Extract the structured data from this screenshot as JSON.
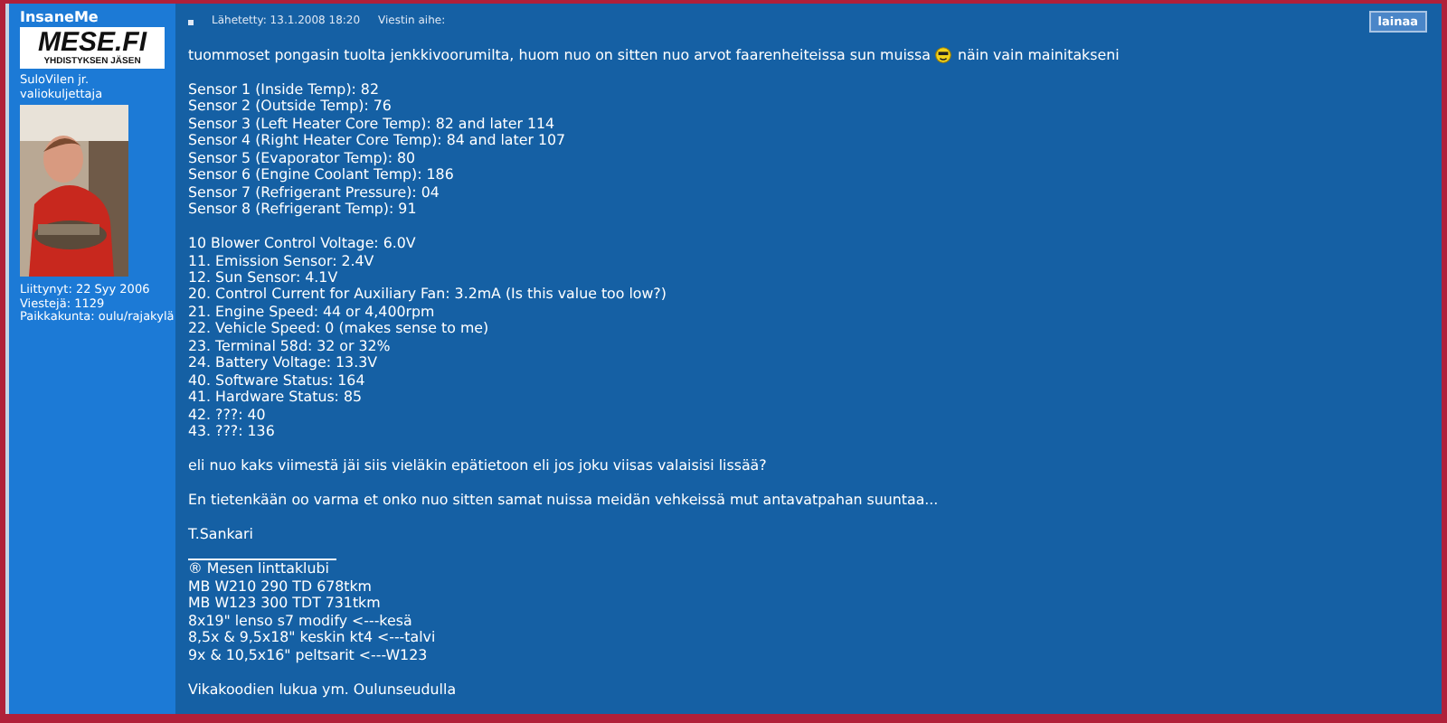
{
  "author": {
    "username": "InsaneMe",
    "logo_title": "MESE.FI",
    "logo_subtitle": "YHDISTYKSEN JÄSEN",
    "rank_lines": [
      "SuloVilen jr.",
      "valiokuljettaja"
    ],
    "avatar": {
      "kind": "picture"
    },
    "info": [
      "Liittynyt: 22 Syy 2006",
      "Viestejä: 1129",
      "Paikkakunta: oulu/rajakylä"
    ]
  },
  "post_header": {
    "posted": "Lähetetty: 13.1.2008 18:20",
    "subject_label": "Viestin aihe:"
  },
  "quote_button": "lainaa",
  "body": [
    {
      "kind": "intro",
      "before": "tuommoset pongasin tuolta jenkkivoorumilta, huom nuo on sitten nuo arvot faarenheiteissa sun muissa",
      "after": "näin vain mainitakseni"
    },
    {
      "kind": "lines",
      "lines": [
        "Sensor 1 (Inside Temp): 82",
        "Sensor 2 (Outside Temp): 76",
        "Sensor 3 (Left Heater Core Temp): 82 and later 114",
        "Sensor 4 (Right Heater Core Temp): 84 and later 107",
        "Sensor 5 (Evaporator Temp): 80",
        "Sensor 6 (Engine Coolant Temp): 186",
        "Sensor 7 (Refrigerant Pressure): 04",
        "Sensor 8 (Refrigerant Temp): 91"
      ]
    },
    {
      "kind": "lines",
      "lines": [
        "10 Blower Control Voltage: 6.0V",
        "11. Emission Sensor: 2.4V",
        "12. Sun Sensor: 4.1V",
        "20. Control Current for Auxiliary Fan: 3.2mA (Is this value too low?)",
        "21. Engine Speed: 44 or 4,400rpm",
        "22. Vehicle Speed: 0 (makes sense to me)",
        "23. Terminal 58d: 32 or 32%",
        "24. Battery Voltage: 13.3V",
        "40. Software Status: 164",
        "41. Hardware Status: 85",
        "42. ???: 40",
        "43. ???: 136"
      ]
    },
    {
      "kind": "lines",
      "lines": [
        "eli nuo kaks viimestä jäi siis vieläkin epätietoon eli jos joku viisas valaisisi lissää?"
      ]
    },
    {
      "kind": "lines",
      "lines": [
        "En tietenkään oo varma et onko nuo sitten samat nuissa meidän vehkeissä mut antavatpahan suuntaa..."
      ]
    },
    {
      "kind": "lines",
      "lines": [
        "T.Sankari"
      ]
    }
  ],
  "signature": {
    "lines": [
      "® Mesen linttaklubi",
      "MB W210 290 TD 678tkm",
      "MB W123 300 TDT 731tkm",
      "8x19\" lenso s7 modify <---kesä",
      "8,5x & 9,5x18\" keskin kt4 <---talvi",
      "9x & 10,5x16\" peltsarit <---W123"
    ],
    "footer": "Vikakoodien lukua ym. Oulunseudulla"
  }
}
